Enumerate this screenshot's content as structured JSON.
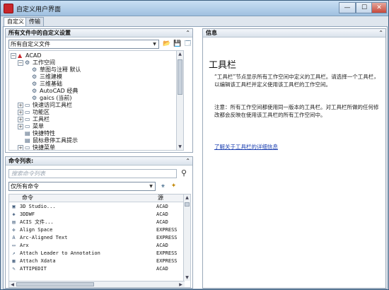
{
  "window": {
    "title": "自定义用户界面",
    "min_label": "—",
    "max_label": "☐",
    "close_label": "✕"
  },
  "tabs": [
    {
      "label": "自定义"
    },
    {
      "label": "传输"
    }
  ],
  "tree_panel": {
    "header": "所有文件中的自定义设置",
    "collapse": "⌃",
    "file_combo": "所有自定义文件",
    "nodes": [
      {
        "label": "ACAD",
        "expander": "−",
        "icon": "▲"
      },
      {
        "label": "工作空间",
        "expander": "−",
        "icon": "⚙"
      },
      {
        "label": "草图与注释 默认",
        "expander": "",
        "icon": "⚙"
      },
      {
        "label": "三维建模",
        "expander": "",
        "icon": "⚙"
      },
      {
        "label": "三维基础",
        "expander": "",
        "icon": "⚙"
      },
      {
        "label": "AutoCAD 经典",
        "expander": "",
        "icon": "⚙"
      },
      {
        "label": "gaics (当前)",
        "expander": "",
        "icon": "⚙"
      },
      {
        "label": "快速访问工具栏",
        "expander": "+",
        "icon": "▭"
      },
      {
        "label": "功能区",
        "expander": "+",
        "icon": "▭"
      },
      {
        "label": "工具栏",
        "expander": "+",
        "icon": "▭"
      },
      {
        "label": "菜单",
        "expander": "+",
        "icon": "▭"
      },
      {
        "label": "快捷特性",
        "expander": "",
        "icon": "▤"
      },
      {
        "label": "鼠标悬停工具提示",
        "expander": "",
        "icon": "▤"
      },
      {
        "label": "快捷菜单",
        "expander": "+",
        "icon": "▭"
      }
    ]
  },
  "command_panel": {
    "header": "命令列表:",
    "collapse": "⌃",
    "search_placeholder": "搜索命令列表",
    "filter_combo": "仅所有命令",
    "col_command": "命令",
    "col_source": "源",
    "rows": [
      {
        "name": "3D Studio...",
        "source": "ACAD",
        "icon": "▣"
      },
      {
        "name": "3DDWF",
        "source": "ACAD",
        "icon": "◈"
      },
      {
        "name": "ACIS 文件...",
        "source": "ACAD",
        "icon": "▤"
      },
      {
        "name": "Align Space",
        "source": "EXPRESS",
        "icon": "✜"
      },
      {
        "name": "Arc-Aligned Text",
        "source": "EXPRESS",
        "icon": "A"
      },
      {
        "name": "Arx",
        "source": "ACAD",
        "icon": "▭"
      },
      {
        "name": "Attach Leader to Annotation",
        "source": "EXPRESS",
        "icon": "↗"
      },
      {
        "name": "Attach Xdata",
        "source": "EXPRESS",
        "icon": "▦"
      },
      {
        "name": "ATTIPEDIT",
        "source": "ACAD",
        "icon": "✎"
      }
    ]
  },
  "info_panel": {
    "header": "信息",
    "collapse": "⌃",
    "title": "工具栏",
    "paragraph1": "“工具栏”节点显示所有工作空间中定义的工具栏。请选择一个工具栏，以编辑该工具栏并定义使用该工具栏的工作空间。",
    "paragraph2": "注意：所有工作空间都使用同一版本的工具栏。对工具栏所做的任何修改都会反映在使用该工具栏的所有工作空间中。",
    "link": "了解关于工具栏的详细信息"
  }
}
